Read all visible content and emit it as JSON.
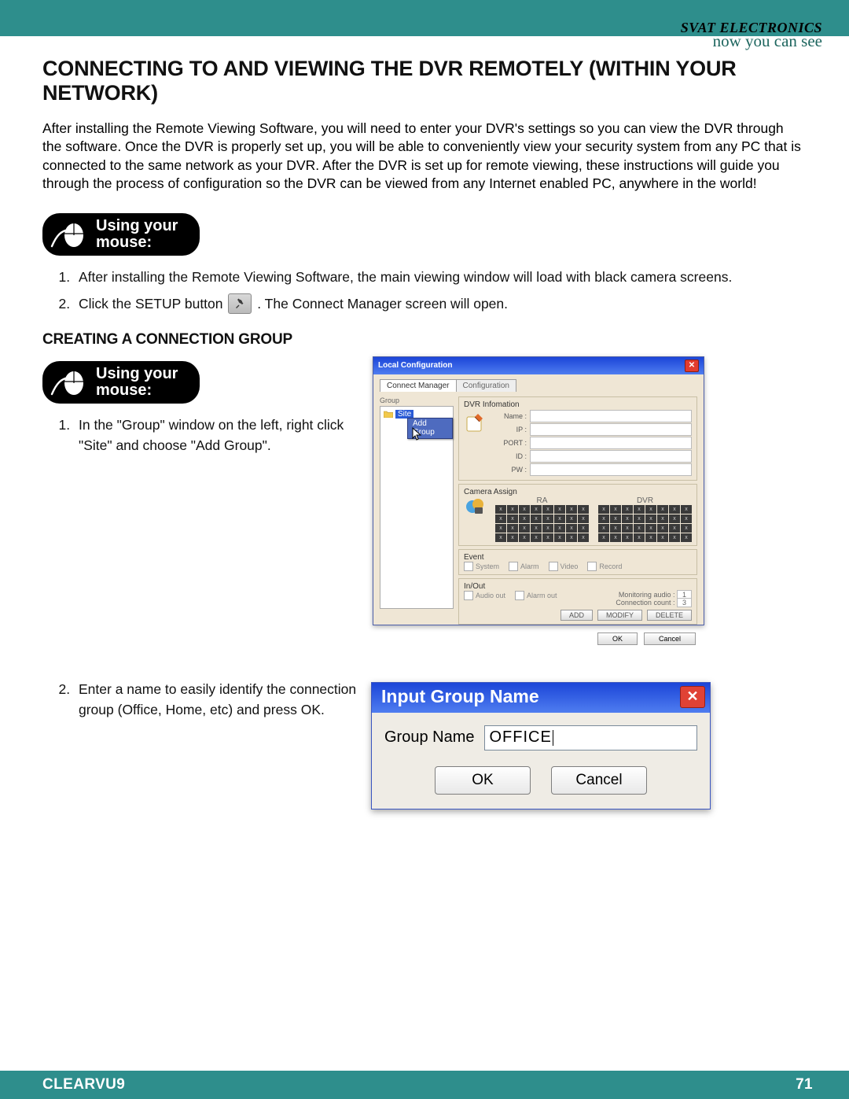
{
  "brand": {
    "company": "SVAT ELECTRONICS",
    "tagline": "now you can see"
  },
  "heading": "CONNECTING TO AND VIEWING THE DVR REMOTELY (WITHIN YOUR NETWORK)",
  "intro": "After installing the Remote Viewing Software, you will need to enter your DVR's settings so you can view the DVR through the software.  Once the DVR is properly set up, you will be able to conveniently view your security system from any PC that is connected to the same network as your DVR. After the DVR is set up for remote viewing, these instructions will guide you through the process of configuration so the DVR can be viewed from any Internet enabled PC, anywhere in the world!",
  "mouse_label": "Using your\nmouse:",
  "steps1": {
    "s1": "After installing the Remote Viewing Software, the main viewing window will load with black camera screens.",
    "s2a": "Click the SETUP button",
    "s2b": ". The Connect Manager screen will open."
  },
  "subheading": "CREATING A CONNECTION GROUP",
  "steps2": {
    "s1": "In the \"Group\" window on the left, right click \"Site\" and choose \"Add Group\".",
    "s2": "Enter a name to easily identify the connection group (Office, Home, etc) and press OK."
  },
  "localcfg": {
    "title": "Local Configuration",
    "tabs": {
      "active": "Connect Manager",
      "inactive": "Configuration"
    },
    "group_hdr": "Group",
    "site_label": "Site",
    "add_group": "Add Group",
    "dvr_info": {
      "hdr": "DVR Infomation",
      "name": "Name :",
      "ip": "IP :",
      "port": "PORT :",
      "id": "ID :",
      "pw": "PW :"
    },
    "camera": {
      "hdr": "Camera Assign",
      "ra": "RA",
      "dvr": "DVR"
    },
    "event": {
      "hdr": "Event",
      "system": "System",
      "alarm": "Alarm",
      "video": "Video",
      "record": "Record"
    },
    "inout": {
      "hdr": "In/Out",
      "audio_out": "Audio out",
      "alarm_out": "Alarm out",
      "mon_audio": "Monitoring audio :",
      "mon_audio_val": "1",
      "conn_cnt": "Connection count :",
      "conn_cnt_val": "3"
    },
    "btns": {
      "add": "ADD",
      "modify": "MODIFY",
      "delete": "DELETE",
      "ok": "OK",
      "cancel": "Cancel"
    }
  },
  "dlg": {
    "title": "Input Group Name",
    "label": "Group Name",
    "value": "OFFICE",
    "ok": "OK",
    "cancel": "Cancel"
  },
  "footer": {
    "model": "CLEARVU9",
    "page": "71"
  }
}
